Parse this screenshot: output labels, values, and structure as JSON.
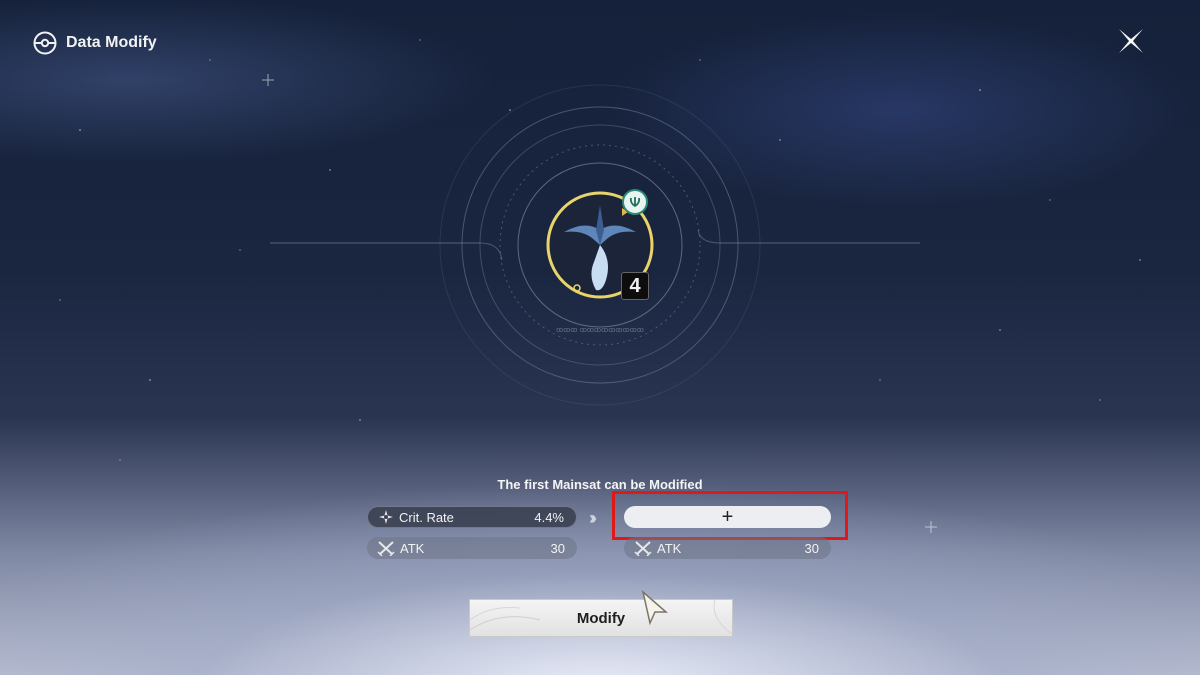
{
  "header": {
    "title": "Data Modify",
    "title_icon": "pokeball-icon",
    "close_icon": "close-x-icon"
  },
  "echo": {
    "level": "4",
    "attribute_icon": "aero-attribute-icon"
  },
  "panel": {
    "subtitle": "The first Mainsat can be Modified",
    "current_main": {
      "icon": "crit-rate-icon",
      "label": "Crit. Rate",
      "value": "4.4%"
    },
    "current_sub": {
      "icon": "atk-swords-icon",
      "label": "ATK",
      "value": "30"
    },
    "arrow": "››",
    "new_main": {
      "placeholder_symbol": "+"
    },
    "new_sub": {
      "icon": "atk-swords-icon",
      "label": "ATK",
      "value": "30"
    }
  },
  "actions": {
    "modify_label": "Modify"
  },
  "colors": {
    "highlight": "#e01818",
    "ring": "#e8d46a",
    "attribute": "#2a8a78"
  }
}
